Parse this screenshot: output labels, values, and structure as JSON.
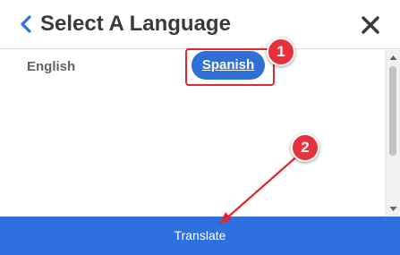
{
  "dialog": {
    "title": "Select A Language",
    "back_icon": "chevron-left-icon",
    "close_icon": "close-icon"
  },
  "languages": {
    "items": [
      {
        "label": "English",
        "selected": false
      },
      {
        "label": "Spanish",
        "selected": true
      }
    ]
  },
  "annotations": {
    "step1": "1",
    "step2": "2"
  },
  "footer": {
    "translate_label": "Translate"
  },
  "colors": {
    "accent": "#2d70e0",
    "selected_pill": "#2f6fd6",
    "annotation_red": "#e0262e",
    "title_text": "#3a3a3a",
    "option_text": "#5f6368"
  }
}
